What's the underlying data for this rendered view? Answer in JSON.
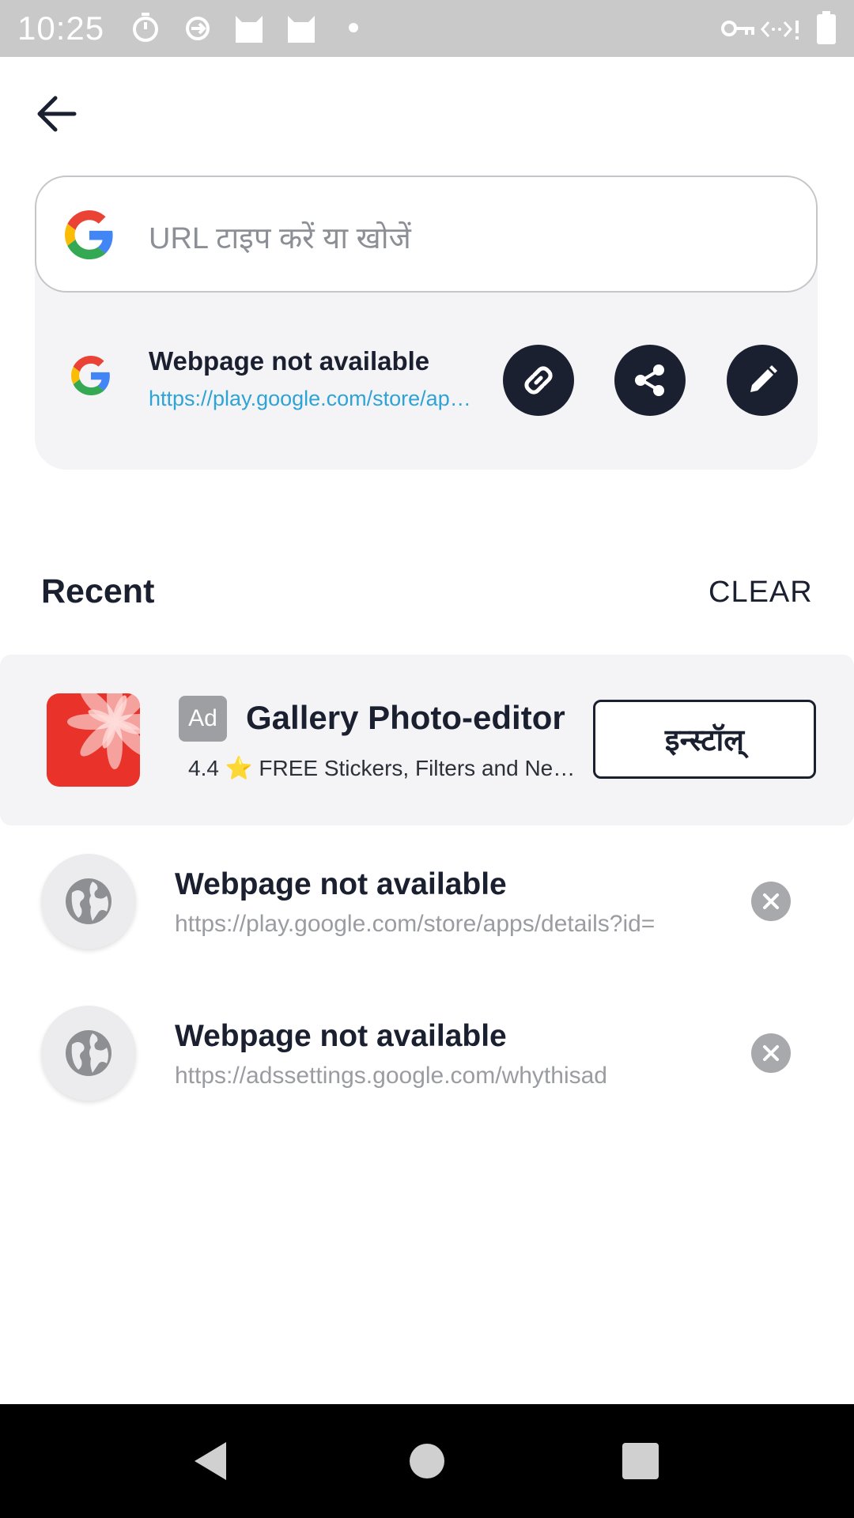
{
  "status_bar": {
    "time": "10:25",
    "left_icons": [
      "timer-icon",
      "sync-icon",
      "cat-icon",
      "cat-icon",
      "dot-icon"
    ],
    "right_icons": [
      "vpn-key-icon",
      "data-arrows-icon",
      "battery-icon"
    ]
  },
  "header": {
    "back_icon": "arrow-back-icon"
  },
  "search": {
    "placeholder": "URL टाइप करें या खोजें"
  },
  "current_page": {
    "title": "Webpage not available",
    "url": "https://play.google.com/store/apps/details",
    "actions": [
      "copy-link-icon",
      "share-icon",
      "edit-icon"
    ]
  },
  "recent": {
    "heading": "Recent",
    "clear_label": "CLEAR"
  },
  "ad": {
    "badge": "Ad",
    "title": "Gallery Photo-editor",
    "rating": "4.4",
    "star": "⭐",
    "tagline": "FREE Stickers, Filters and Neon effects",
    "install_label": "इन्स्टॉल्"
  },
  "history": [
    {
      "title": "Webpage not available",
      "url": "https://play.google.com/store/apps/details?id="
    },
    {
      "title": "Webpage not available",
      "url": "https://adssettings.google.com/whythisad"
    }
  ],
  "colors": {
    "primary_dark": "#1b2030",
    "link_blue": "#2ea3d6",
    "ad_icon_red": "#e8322a"
  },
  "nav": [
    "back-triangle-icon",
    "home-circle-icon",
    "recents-square-icon"
  ]
}
